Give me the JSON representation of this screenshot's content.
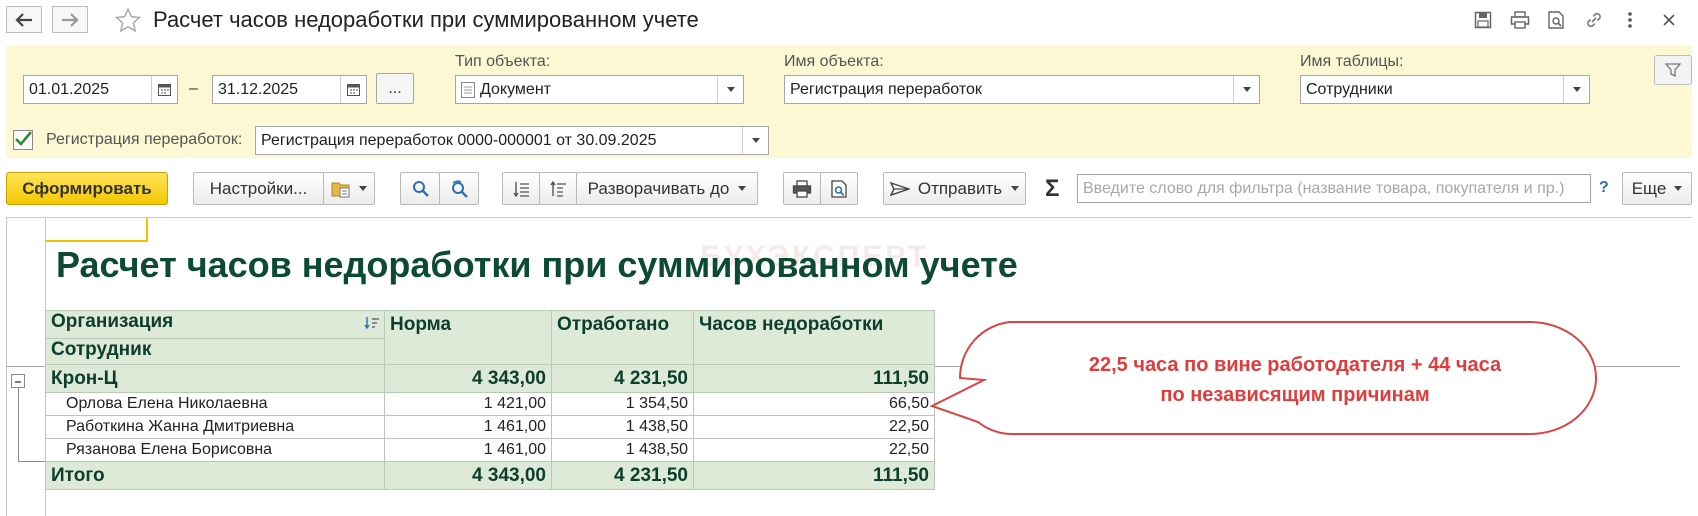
{
  "window": {
    "title": "Расчет часов недоработки при суммированном учете",
    "icons": [
      "back-icon",
      "forward-icon",
      "star-icon",
      "save-icon",
      "print-icon",
      "preview-icon",
      "link-icon",
      "more-vert-icon",
      "close-icon"
    ]
  },
  "filters": {
    "date_from": "01.01.2025",
    "date_sep": "–",
    "date_to": "31.12.2025",
    "period_button": "...",
    "object_type_label": "Тип объекта:",
    "object_type_value": "Документ",
    "object_name_label": "Имя объекта:",
    "object_name_value": "Регистрация переработок",
    "table_name_label": "Имя таблицы:",
    "table_name_value": "Сотрудники",
    "registration_label": "Регистрация переработок:",
    "registration_value": "Регистрация переработок 0000-000001 от 30.09.2025",
    "registration_checked": true
  },
  "toolbar": {
    "generate": "Сформировать",
    "settings": "Настройки...",
    "expand_to": "Разворачивать до",
    "send": "Отправить",
    "sigma": "Σ",
    "search_placeholder": "Введите слово для фильтра (название товара, покупателя и пр.)",
    "help": "?",
    "more": "Еще"
  },
  "report": {
    "title": "Расчет часов недоработки при суммированном учете",
    "watermark": "БУХЭКСПЕРТ",
    "headers": {
      "organization": "Организация",
      "employee": "Сотрудник",
      "norm": "Норма",
      "worked": "Отработано",
      "shortfall": "Часов недоработки"
    },
    "group": {
      "name": "Крон-Ц",
      "norm": "4 343,00",
      "worked": "4 231,50",
      "shortfall": "111,50"
    },
    "rows": [
      {
        "name": "Орлова Елена Николаевна",
        "norm": "1 421,00",
        "worked": "1 354,50",
        "shortfall": "66,50"
      },
      {
        "name": "Работкина Жанна Дмитриевна",
        "norm": "1 461,00",
        "worked": "1 438,50",
        "shortfall": "22,50"
      },
      {
        "name": "Рязанова Елена Борисовна",
        "norm": "1 461,00",
        "worked": "1 438,50",
        "shortfall": "22,50"
      }
    ],
    "total": {
      "name": "Итого",
      "norm": "4 343,00",
      "worked": "4 231,50",
      "shortfall": "111,50"
    }
  },
  "callout": {
    "line1": "22,5 часа по вине работодателя + 44 часа",
    "line2": "по независящим причинам"
  },
  "colors": {
    "panel_bg": "#fbf8d3",
    "primary_btn": "#f3c800",
    "report_title": "#0d4a33",
    "table_header_bg": "#dcead7",
    "callout_text": "#e03c3c",
    "callout_border": "#d84545"
  }
}
